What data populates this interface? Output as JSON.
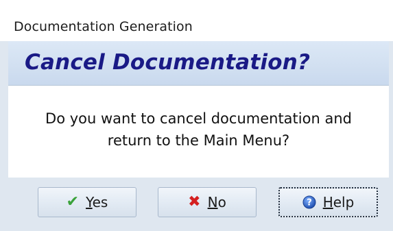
{
  "window": {
    "title": "Documentation Generation"
  },
  "header": {
    "title": "Cancel Documentation?"
  },
  "message": {
    "line1": "Do you want to cancel documentation and",
    "line2": "return to the Main Menu?"
  },
  "buttons": {
    "yes": {
      "label": "Yes",
      "icon": "check-icon"
    },
    "no": {
      "label": "No",
      "icon": "x-icon"
    },
    "help": {
      "label": "Help",
      "icon": "help-icon"
    }
  },
  "colors": {
    "header_text": "#1a1a86",
    "header_band": "#d2e0f1",
    "footer_bg": "#dfe7f0",
    "check": "#3aa23a",
    "x": "#d42020",
    "help": "#2f62c2"
  }
}
